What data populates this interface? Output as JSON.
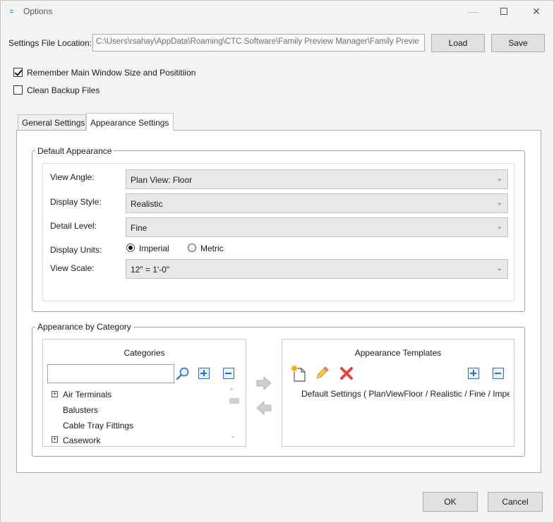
{
  "window": {
    "title": "Options",
    "minimize_glyph": "—",
    "close_glyph": "✕",
    "accent": "#3a7bd5"
  },
  "settings_file": {
    "label": "Settings File Location:",
    "value": "C:\\Users\\rsahay\\AppData\\Roaming\\CTC Software\\Family Preview Manager\\Family Previe",
    "load_label": "Load",
    "save_label": "Save"
  },
  "options": {
    "remember_label": "Remember Main Window Size and Posititiion",
    "remember_checked": true,
    "clean_label": "Clean Backup Files",
    "clean_checked": false
  },
  "tabs": [
    {
      "label": "General Settings",
      "active": false
    },
    {
      "label": "Appearance Settings",
      "active": true
    }
  ],
  "default_appearance": {
    "title": "Default Appearance",
    "view_angle": {
      "label": "View Angle:",
      "value": "Plan View: Floor"
    },
    "display_style": {
      "label": "Display Style:",
      "value": "Realistic"
    },
    "detail_level": {
      "label": "Detail Level:",
      "value": "Fine"
    },
    "display_units": {
      "label": "Display Units:",
      "options": [
        {
          "label": "Imperial",
          "selected": true
        },
        {
          "label": "Metric",
          "selected": false
        }
      ]
    },
    "view_scale": {
      "label": "View Scale:",
      "value": "12\" = 1'-0\""
    },
    "dropdown_glyph": "⌄"
  },
  "appearance_by_category": {
    "title": "Appearance by Category",
    "categories": {
      "title": "Categories",
      "search_value": "",
      "items": [
        {
          "label": "Air Terminals",
          "expander": "+"
        },
        {
          "label": "Balusters",
          "expander": ""
        },
        {
          "label": "Cable Tray Fittings",
          "expander": ""
        },
        {
          "label": "Casework",
          "expander": "+"
        }
      ],
      "scroll_up_glyph": "^",
      "scroll_down_glyph": "⌄"
    },
    "templates": {
      "title": "Appearance Templates",
      "items": [
        {
          "label": "Default Settings ( PlanViewFloor / Realistic / Fine / Impe"
        }
      ]
    }
  },
  "footer": {
    "ok_label": "OK",
    "cancel_label": "Cancel"
  },
  "icons": {
    "search": "search-icon",
    "expand_all": "plus-box-icon",
    "collapse_all": "minus-box-icon",
    "new_template": "new-document-icon",
    "edit_template": "pencil-icon",
    "delete_template": "red-x-icon",
    "move_right": "arrow-right-icon",
    "move_left": "arrow-left-icon"
  }
}
